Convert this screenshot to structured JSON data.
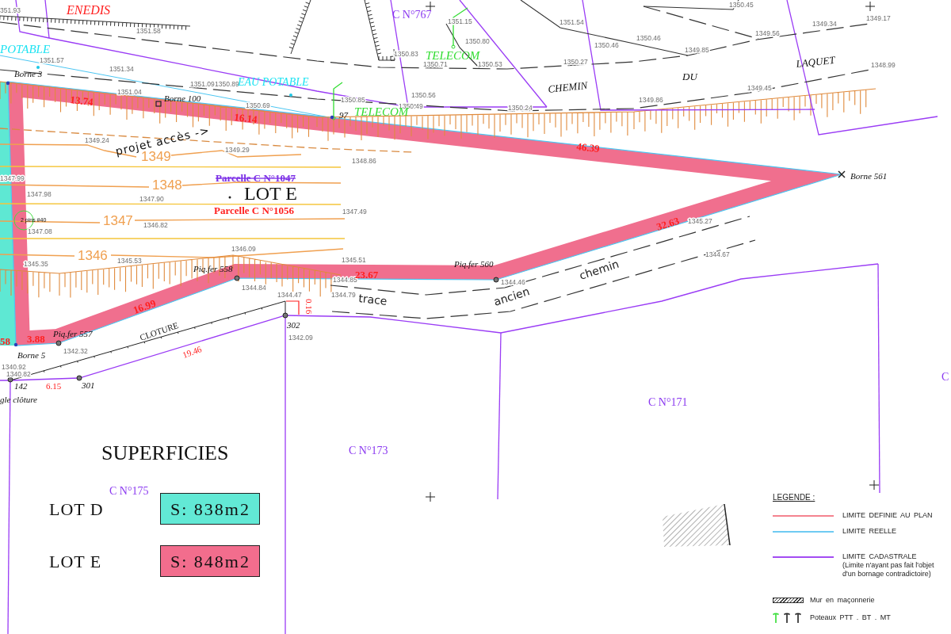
{
  "plan": {
    "network_labels": [
      {
        "text": "ENEDIS",
        "color": "#ff2020"
      },
      {
        "text": "POTABLE",
        "color": "#1ee3f2"
      },
      {
        "text": "EAU POTABLE",
        "color": "#1ee3f2"
      },
      {
        "text": "TELECOM",
        "color": "#33dd33"
      },
      {
        "text": "TELECOM",
        "color": "#33dd33"
      }
    ],
    "parcel_numbers": [
      "C N°767",
      "C N°171",
      "C N°173",
      "C N°175",
      "C"
    ],
    "parcel_labels": [
      {
        "text": "Parcelle C N°1047",
        "color": "#7b2fe6",
        "struck": true
      },
      {
        "text": "Parcelle C N°1056",
        "color": "#ff2020",
        "struck": false
      }
    ],
    "lot_label": "LOT E",
    "road_names": [
      "CHEMIN",
      "DU",
      "LAQUET"
    ],
    "old_road_labels": [
      "trace",
      "ancien",
      "chemin"
    ],
    "access_note": "projet accès ->",
    "fence_label": "CLOTURE",
    "pins_note": "2 pins #40",
    "contour_labels": [
      "1349",
      "1348",
      "1347",
      "1346"
    ],
    "distances": [
      {
        "text": "13.74",
        "kind": "boundary"
      },
      {
        "text": "16.14",
        "kind": "boundary"
      },
      {
        "text": "46.39",
        "kind": "boundary"
      },
      {
        "text": "32.63",
        "kind": "boundary"
      },
      {
        "text": "23.67",
        "kind": "boundary"
      },
      {
        "text": "16.99",
        "kind": "boundary"
      },
      {
        "text": "3.88",
        "kind": "boundary"
      },
      {
        "text": "58",
        "kind": "boundary"
      },
      {
        "text": "6.15",
        "kind": "cadastral"
      },
      {
        "text": "19.46",
        "kind": "cadastral"
      },
      {
        "text": "0.16",
        "kind": "cadastral"
      }
    ],
    "points": [
      "Borne 3",
      "Borne 100",
      "Borne 561",
      "Piq.fer 560",
      "Piq.fer 558",
      "Piq.fer 557",
      "Borne 5",
      "142",
      "301",
      "302",
      "97",
      "gle clôture"
    ],
    "elevations": [
      "351.93",
      "1351.58",
      "1351.57",
      "1351.34",
      "1351.04",
      "1351.09",
      "1350.89",
      "1350.69",
      "1349.24",
      "1349.29",
      "1348.86",
      "1347.99",
      "1347.98",
      "1347.90",
      "1347.49",
      "1346.82",
      "1347.08",
      "1346.09",
      "1345.53",
      "1345.35",
      "1345.51",
      "1344.84",
      "1344.85",
      "1344.79",
      "1344.47",
      "1342.09",
      "1342.32",
      "1340.92",
      "1340.82",
      "1344.46",
      "1345.27",
      "1344.67",
      "1351.15",
      "1350.80",
      "1350.83",
      "1350.71",
      "1350.53",
      "1350.56",
      "1350.49",
      "1350.85",
      "1350.24",
      "1351.54",
      "1350.27",
      "1350.46",
      "1350.45",
      "1350.46",
      "1349.85",
      "1349.56",
      "1349.34",
      "1349.17",
      "1348.99",
      "1349.45",
      "1349.86"
    ]
  },
  "areas": {
    "title": "SUPERFICIES",
    "lots": [
      {
        "name": "LOT D",
        "area": "S: 838m2",
        "color": "#62e9d5"
      },
      {
        "name": "LOT E",
        "area": "S: 848m2",
        "color": "#f26d8d"
      }
    ]
  },
  "legend": {
    "title": "LEGENDE :",
    "items": [
      {
        "kind": "line",
        "color": "#f4838f",
        "label": "LIMITE DEFINIE AU PLAN"
      },
      {
        "kind": "line",
        "color": "#6fcbf2",
        "label": "LIMITE REELLE"
      },
      {
        "kind": "line",
        "color": "#a34cf2",
        "label": "LIMITE CADASTRALE",
        "note": "(Limite n'ayant pas fait l'objet d'un bornage contradictoire)"
      },
      {
        "kind": "wall",
        "label": "Mur en maçonnerie"
      },
      {
        "kind": "poles",
        "label": "Poteaux PTT . BT . MT"
      }
    ]
  }
}
